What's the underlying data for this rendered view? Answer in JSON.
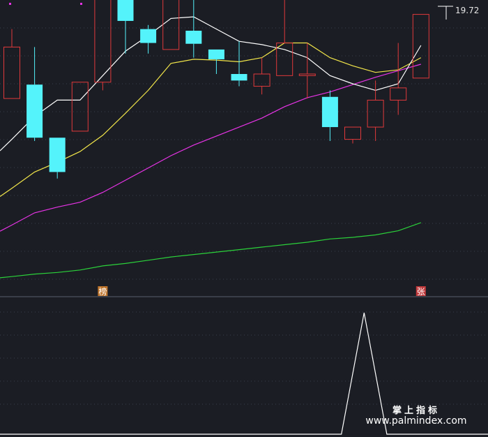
{
  "chart_data": {
    "type": "candlestick",
    "price_label": "19.72",
    "colors": {
      "background": "#1b1d24",
      "up": "#e0393b",
      "down": "#54f3fb",
      "ma_white": "#ffffff",
      "ma_yellow": "#f2e64a",
      "ma_magenta": "#e733e6",
      "ma_green": "#2bd23a",
      "grid": "#3a3f4c",
      "divider": "#5a5f6b",
      "marker_bang_bg": "#c0762d",
      "marker_zhang_bg": "#c0393b",
      "indicator": "#ffffff"
    },
    "candles": [
      {
        "o": 15.7,
        "c": 16.33,
        "h": 16.55,
        "l": 15.7
      },
      {
        "o": 15.87,
        "c": 15.22,
        "h": 16.33,
        "l": 15.18
      },
      {
        "o": 15.22,
        "c": 14.8,
        "h": 15.22,
        "l": 14.72
      },
      {
        "o": 15.3,
        "c": 15.9,
        "h": 15.9,
        "l": 15.3
      },
      {
        "o": 15.9,
        "c": 17.0,
        "h": 17.0,
        "l": 15.8
      },
      {
        "o": 17.0,
        "c": 16.65,
        "h": 17.0,
        "l": 16.25
      },
      {
        "o": 16.55,
        "c": 16.38,
        "h": 16.6,
        "l": 16.25
      },
      {
        "o": 16.3,
        "c": 16.98,
        "h": 17.55,
        "l": 16.3
      },
      {
        "o": 16.53,
        "c": 16.37,
        "h": 17.42,
        "l": 16.2
      },
      {
        "o": 16.3,
        "c": 16.18,
        "h": 16.3,
        "l": 16.0
      },
      {
        "o": 16.0,
        "c": 15.92,
        "h": 16.4,
        "l": 15.85
      },
      {
        "o": 15.85,
        "c": 16.0,
        "h": 16.2,
        "l": 15.75
      },
      {
        "o": 15.98,
        "c": 16.38,
        "h": 16.93,
        "l": 15.98
      },
      {
        "o": 15.98,
        "c": 16.0,
        "h": 16.38,
        "l": 15.7
      },
      {
        "o": 15.72,
        "c": 15.35,
        "h": 15.8,
        "l": 15.18
      },
      {
        "o": 15.2,
        "c": 15.35,
        "h": 15.35,
        "l": 15.15
      },
      {
        "o": 15.35,
        "c": 15.68,
        "h": 15.92,
        "l": 15.18
      },
      {
        "o": 15.68,
        "c": 15.83,
        "h": 16.38,
        "l": 15.5
      },
      {
        "o": 15.95,
        "c": 16.73,
        "h": 16.73,
        "l": 15.95
      }
    ],
    "ma_white": [
      15.2,
      15.48,
      15.68,
      15.68,
      15.98,
      16.28,
      16.47,
      16.68,
      16.7,
      16.55,
      16.4,
      16.36,
      16.3,
      16.2,
      15.98,
      15.88,
      15.8,
      15.88,
      16.35
    ],
    "ma_yellow": [
      14.6,
      14.8,
      14.92,
      15.05,
      15.25,
      15.52,
      15.8,
      16.13,
      16.18,
      16.17,
      16.15,
      16.2,
      16.38,
      16.38,
      16.2,
      16.1,
      16.02,
      16.05,
      16.2
    ],
    "ma_magenta": [
      14.15,
      14.3,
      14.37,
      14.43,
      14.55,
      14.7,
      14.85,
      15.0,
      15.13,
      15.24,
      15.35,
      15.46,
      15.6,
      15.71,
      15.78,
      15.87,
      15.96,
      16.04,
      16.12
    ],
    "ma_green": [
      13.52,
      13.55,
      13.57,
      13.6,
      13.65,
      13.68,
      13.72,
      13.76,
      13.79,
      13.82,
      13.85,
      13.88,
      13.91,
      13.94,
      13.98,
      14.0,
      14.03,
      14.08,
      14.18
    ],
    "markers": [
      {
        "index": 4,
        "text": "榜"
      },
      {
        "index": 18,
        "text": "张"
      }
    ],
    "indicator": [
      {
        "x": 0,
        "v": 0
      },
      {
        "x": 14.5,
        "v": 0
      },
      {
        "x": 15.5,
        "v": 1
      },
      {
        "x": 16.5,
        "v": 0
      },
      {
        "x": 18.5,
        "v": 0
      }
    ],
    "watermark": {
      "line1": "掌上指标",
      "line2": "www.palmindex.com"
    }
  }
}
